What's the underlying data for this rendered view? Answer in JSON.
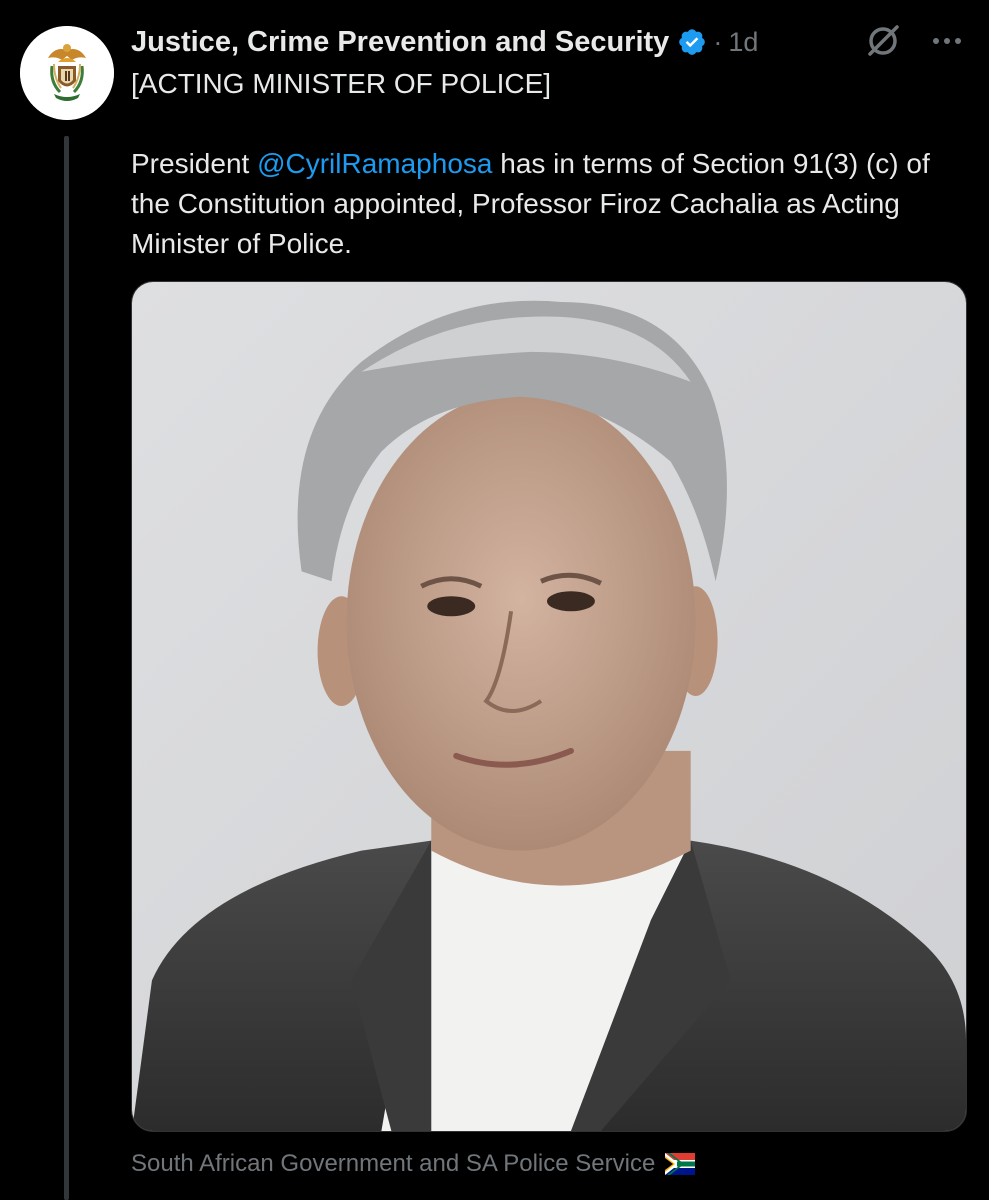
{
  "post": {
    "author": {
      "display_name": "Justice, Crime Prevention and Security",
      "verified": true,
      "time": "1d",
      "separator": "·"
    },
    "title_line": "[ACTING MINISTER OF POLICE]",
    "body": {
      "before_mention": "President ",
      "mention": "@CyrilRamaphosa",
      "after_mention": " has in terms of Section 91(3) (c) of the Constitution appointed, Professor Firoz Cachalia as Acting Minister of Police."
    },
    "media_caption": "South African Government and SA Police Service"
  },
  "icons": {
    "verified": "verified-badge-icon",
    "grok": "grok-icon",
    "more": "more-options-icon",
    "flag": "south-africa-flag-icon"
  },
  "colors": {
    "background": "#000000",
    "text_primary": "#e7e9ea",
    "text_secondary": "#71767b",
    "accent": "#1d9bf0",
    "thread_line": "#333639"
  }
}
